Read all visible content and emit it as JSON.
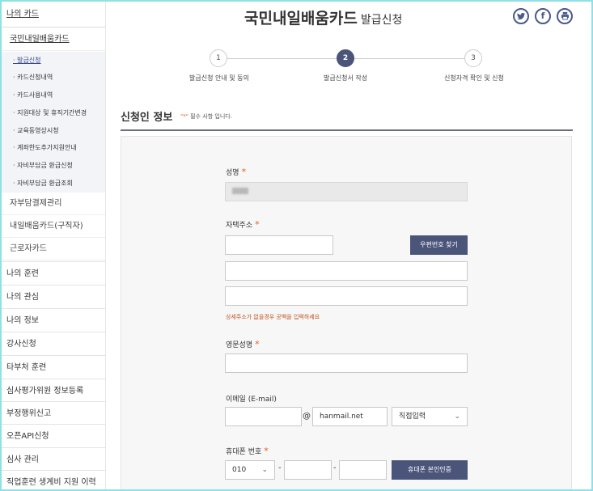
{
  "sidebar": {
    "top": "나의 카드",
    "sub": "국민내일배움카드",
    "subitems": [
      "· 발급신청",
      "· 카드신청내역",
      "· 카드사용내역",
      "· 지원대상 및 휴직기간변경",
      "· 교육동영상시청",
      "· 계좌한도추가지원안내",
      "· 자비부담금 환급신청",
      "· 자비부담금 환급조회"
    ],
    "menus": [
      "자부담결제관리",
      "내일배움카드(구직자)",
      "근로자카드"
    ],
    "mains": [
      "나의 훈련",
      "나의 관심",
      "나의 정보",
      "강사신청",
      "타부처 훈련",
      "심사평가위원 정보등록",
      "부정행위신고",
      "오픈API신청",
      "심사 관리",
      "직업훈련 생계비 지원 이력"
    ]
  },
  "header": {
    "title": "국민내일배움카드",
    "subtitle": "발급신청",
    "share_icons": [
      "twitter-icon",
      "facebook-icon",
      "print-icon"
    ]
  },
  "steps": [
    {
      "num": "1",
      "label": "발급신청 안내 및 동의"
    },
    {
      "num": "2",
      "label": "발급신청서 작성"
    },
    {
      "num": "3",
      "label": "신청자격 확인 및 신청"
    }
  ],
  "section": {
    "title": "신청인 정보",
    "note_req": "\"*\"",
    "note_text": " 필수 사항 입니다."
  },
  "form": {
    "name_label": "성명",
    "address_label": "자택주소",
    "zip_button": "우편번호 찾기",
    "address_helper": "상세주소가 없을경우 공백을 입력하세요",
    "eng_name_label": "영문성명",
    "email_label": "이메일 (E-mail)",
    "email_at": "@",
    "email_domain": "hanmail.net",
    "email_select": "직접입력",
    "phone_label": "휴대폰 번호",
    "phone_prefix": "010",
    "phone_dash": "-",
    "phone_button": "휴대폰 본인인증",
    "required_mark": "*"
  },
  "colors": {
    "accent": "#4b5579",
    "required": "#e0601c"
  }
}
